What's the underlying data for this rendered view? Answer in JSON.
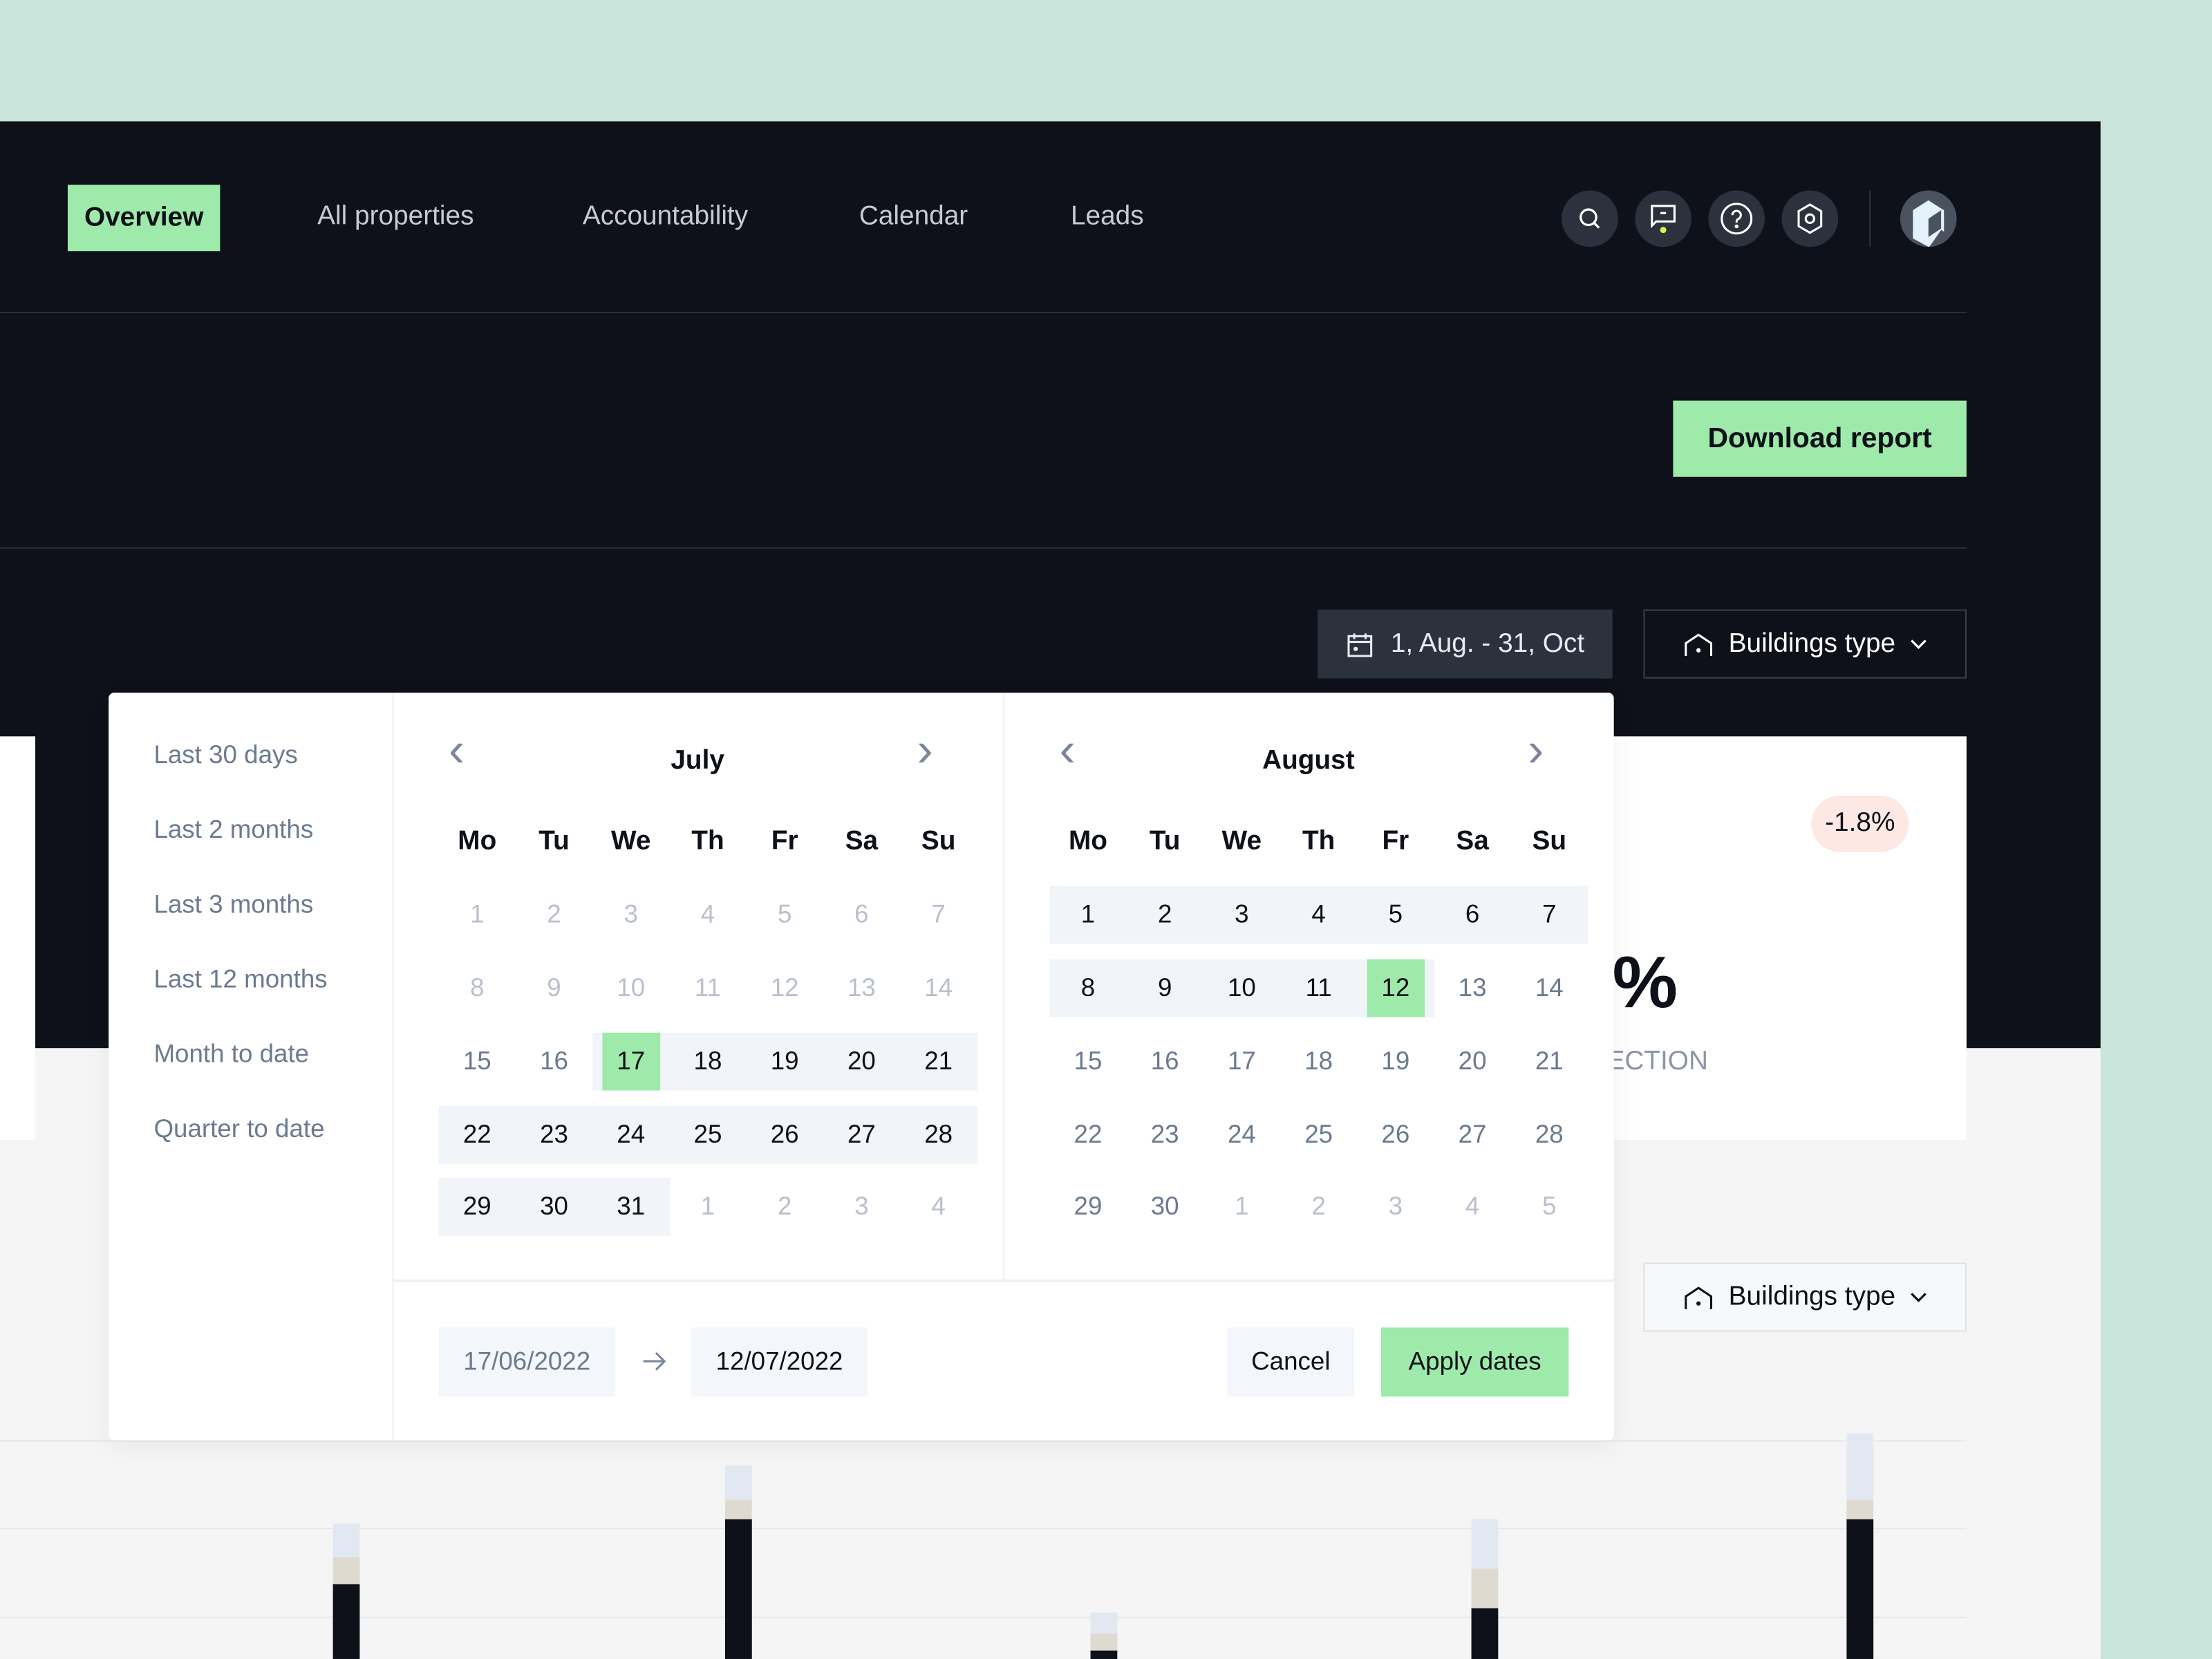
{
  "nav": {
    "items": [
      "Overview",
      "All properties",
      "Accountability",
      "Calendar",
      "Leads"
    ],
    "active": "Overview"
  },
  "header_icons": [
    "search-icon",
    "message-icon",
    "help-icon",
    "settings-icon"
  ],
  "download_label": "Download report",
  "date_range_label": "1, Aug. - 31, Oct",
  "buildings_type_label": "Buildings type",
  "stat": {
    "badge": "-1.8%",
    "value_fragment": "%",
    "label_fragment": "ECTION"
  },
  "picker": {
    "presets": [
      "Last 30 days",
      "Last 2 months",
      "Last 3 months",
      "Last 12 months",
      "Month to date",
      "Quarter to date"
    ],
    "weekdays": [
      "Mo",
      "Tu",
      "We",
      "Th",
      "Fr",
      "Sa",
      "Su"
    ],
    "months": [
      {
        "name": "July",
        "days": [
          [
            1,
            2,
            3,
            4,
            5,
            6,
            7
          ],
          [
            8,
            9,
            10,
            11,
            12,
            13,
            14
          ],
          [
            15,
            16,
            17,
            18,
            19,
            20,
            21
          ],
          [
            22,
            23,
            24,
            25,
            26,
            27,
            28
          ],
          [
            29,
            30,
            31,
            1,
            2,
            3,
            4
          ]
        ],
        "selected": 17,
        "dim_first_rows": 2
      },
      {
        "name": "August",
        "days": [
          [
            1,
            2,
            3,
            4,
            5,
            6,
            7
          ],
          [
            8,
            9,
            10,
            11,
            12,
            13,
            14
          ],
          [
            15,
            16,
            17,
            18,
            19,
            20,
            21
          ],
          [
            22,
            23,
            24,
            25,
            26,
            27,
            28
          ],
          [
            29,
            30,
            1,
            2,
            3,
            4,
            5
          ]
        ],
        "selected": 12
      }
    ],
    "start_date": "17/06/2022",
    "end_date": "12/07/2022",
    "cancel_label": "Cancel",
    "apply_label": "Apply dates"
  },
  "colors": {
    "accent": "#9eeaaa",
    "dark": "#0e1119",
    "background": "#c9e4da",
    "notification": "#d4f54a"
  }
}
